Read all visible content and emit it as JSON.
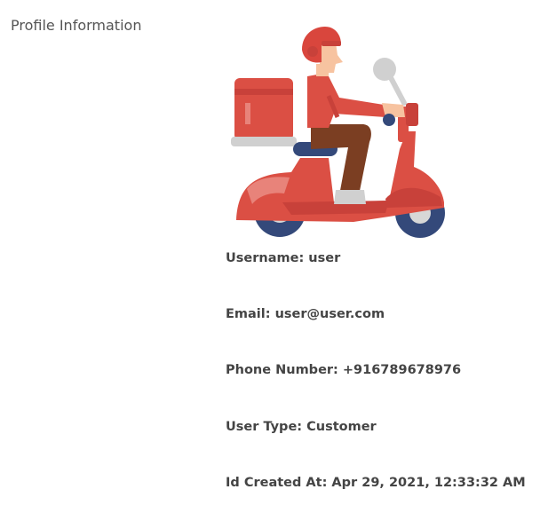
{
  "profile": {
    "section_title": "Profile Information",
    "avatar_icon": "delivery-scooter-rider-icon",
    "fields": {
      "username": "Username: user",
      "email": "Email: user@user.com",
      "phone": "Phone Number: +916789678976",
      "user_type": "User Type: Customer",
      "created_at": "Id Created At: Apr 29, 2021, 12:33:32 AM"
    }
  },
  "colors": {
    "scooter_red": "#DB4F44",
    "scooter_dark_red": "#C8413A",
    "helmet_red": "#D9463D",
    "skin": "#F7C3A0",
    "pants_brown": "#7B3E22",
    "shoe_navy": "#34497A",
    "tire_navy": "#34497A",
    "hub_grey": "#D7D7D7",
    "mirror_grey": "#D0D0D0",
    "text": "#444444"
  }
}
